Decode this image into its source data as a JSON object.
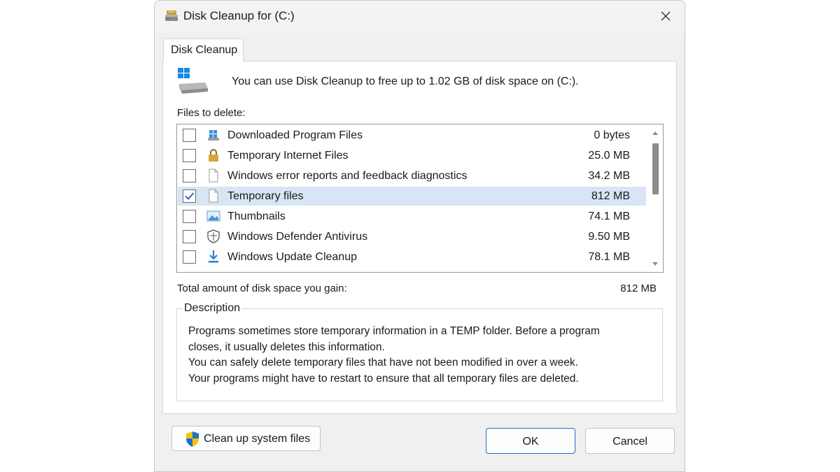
{
  "window": {
    "title": "Disk Cleanup for  (C:)"
  },
  "tab": {
    "label": "Disk Cleanup"
  },
  "intro": {
    "text": "You can use Disk Cleanup to free up to 1.02 GB of disk space on  (C:)."
  },
  "files_label": "Files to delete:",
  "files": [
    {
      "name": "Downloaded Program Files",
      "size": "0 bytes",
      "checked": false,
      "icon": "downloaded-programs-icon"
    },
    {
      "name": "Temporary Internet Files",
      "size": "25.0 MB",
      "checked": false,
      "icon": "lock-icon"
    },
    {
      "name": "Windows error reports and feedback diagnostics",
      "size": "34.2 MB",
      "checked": false,
      "icon": "file-icon"
    },
    {
      "name": "Temporary files",
      "size": "812 MB",
      "checked": true,
      "icon": "file-icon"
    },
    {
      "name": "Thumbnails",
      "size": "74.1 MB",
      "checked": false,
      "icon": "image-icon"
    },
    {
      "name": "Windows Defender Antivirus",
      "size": "9.50 MB",
      "checked": false,
      "icon": "shield-icon"
    },
    {
      "name": "Windows Update Cleanup",
      "size": "78.1 MB",
      "checked": false,
      "icon": "download-arrow-icon"
    }
  ],
  "total": {
    "label": "Total amount of disk space you gain:",
    "value": "812 MB"
  },
  "description": {
    "legend": "Description",
    "lines": [
      "Programs sometimes store temporary information in a TEMP folder. Before a program",
      "closes, it usually deletes this information.",
      "You can safely delete temporary files that have not been modified in over a week.",
      "Your programs might have to restart to ensure that all temporary files are deleted."
    ]
  },
  "buttons": {
    "cleanup_system": "Clean up system files",
    "ok": "OK",
    "cancel": "Cancel"
  },
  "colors": {
    "selected_row": "#d7e5f5",
    "accent": "#1f6fd0",
    "checkmark": "#1a5fb4"
  }
}
